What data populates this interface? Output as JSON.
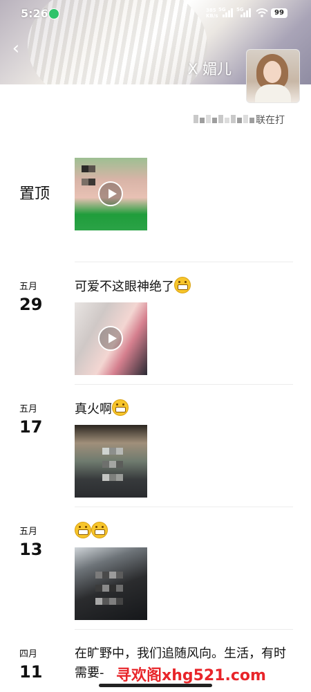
{
  "status_bar": {
    "time": "5:26",
    "net_speed": "385",
    "net_unit": "KB/s",
    "sim1": "5G",
    "sim2": "5G",
    "battery": "99"
  },
  "header": {
    "name": "X 媚儿",
    "signature_suffix": "联在打"
  },
  "pinned": {
    "label": "置顶"
  },
  "posts": [
    {
      "month": "五月",
      "day": "29",
      "text": "可爱不这眼神绝了",
      "emoji_count": 1,
      "is_video": true
    },
    {
      "month": "五月",
      "day": "17",
      "text": "真火啊",
      "emoji_count": 1,
      "is_video": false
    },
    {
      "month": "五月",
      "day": "13",
      "text": "",
      "emoji_count": 2,
      "is_video": false
    },
    {
      "month": "四月",
      "day": "11",
      "text": "在旷野中，我们追随风向。生活，有时需要-",
      "emoji_count": 0,
      "is_video": false
    }
  ],
  "watermark": "寻欢阁xhg521.com",
  "colors": {
    "watermark": "#e8252a",
    "emoji": "#f7c52b",
    "divider": "#ececec"
  }
}
